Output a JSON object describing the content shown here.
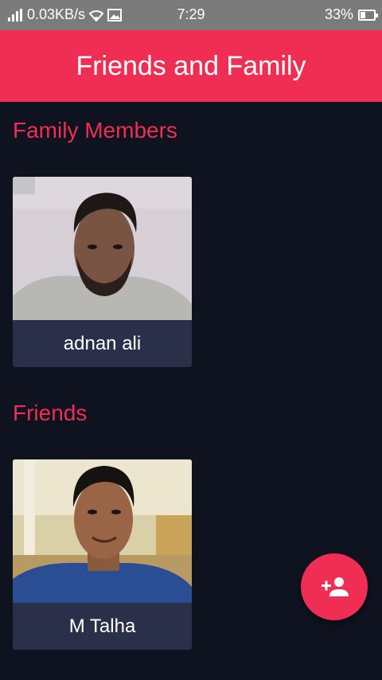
{
  "status_bar": {
    "speed": "0.03KB/s",
    "time": "7:29",
    "battery": "33%"
  },
  "app_bar": {
    "title": "Friends and Family"
  },
  "sections": [
    {
      "heading": "Family Members",
      "people": [
        {
          "name": "adnan ali"
        }
      ]
    },
    {
      "heading": "Friends",
      "people": [
        {
          "name": "M Talha"
        }
      ]
    }
  ],
  "colors": {
    "accent": "#f02e54",
    "background": "#0f1320",
    "card": "#2a3049",
    "status_bar": "#7b7b7b"
  },
  "icons": {
    "fab": "add-person-icon"
  }
}
